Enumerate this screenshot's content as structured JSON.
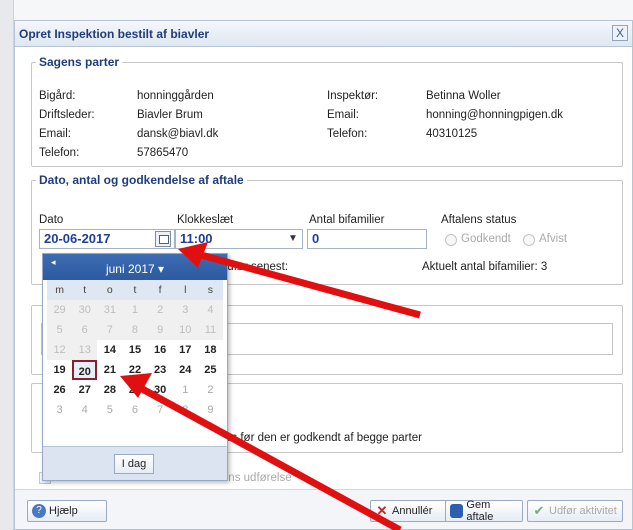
{
  "dialog": {
    "title": "Opret Inspektion bestilt af biavler",
    "close_label": "X"
  },
  "parties": {
    "legend": "Sagens parter",
    "left": [
      {
        "label": "Bigård:",
        "value": "honninggården"
      },
      {
        "label": "Driftsleder:",
        "value": "Biavler Brum"
      },
      {
        "label": "Email:",
        "value": "dansk@biavl.dk"
      },
      {
        "label": "Telefon:",
        "value": "57865470"
      }
    ],
    "right": [
      {
        "label": "Inspektør:",
        "value": "Betinna Woller"
      },
      {
        "label": "Email:",
        "value": "honning@honningpigen.dk"
      },
      {
        "label": "Telefon:",
        "value": "40310125"
      }
    ]
  },
  "agreement": {
    "legend": "Dato, antal og godkendelse af aftale",
    "date_label": "Dato",
    "date_value": "20-06-2017",
    "time_label": "Klokkeslæt",
    "time_value": "11:00",
    "colonies_label": "Antal bifamilier",
    "colonies_value": "0",
    "status_label": "Aftalens status",
    "status_options": [
      "Godkendt",
      "Afvist"
    ],
    "latest_label": "Udfør senest:",
    "current_colonies": "Aktuelt antal bifamilier: 3"
  },
  "approval_text": "fres før den er godkendt af begge parter",
  "beekeeper_present": "Biavleren er tilstede ved aktivitetens udførelse",
  "datepicker": {
    "prev": "◂",
    "month": "juni 2017 ▾",
    "dow": [
      "m",
      "t",
      "o",
      "t",
      "f",
      "l",
      "s"
    ],
    "weeks": [
      [
        "29",
        "30",
        "31",
        "1",
        "2",
        "3",
        "4"
      ],
      [
        "5",
        "6",
        "7",
        "8",
        "9",
        "10",
        "11"
      ],
      [
        "12",
        "13",
        "14",
        "15",
        "16",
        "17",
        "18"
      ],
      [
        "19",
        "20",
        "21",
        "22",
        "23",
        "24",
        "25"
      ],
      [
        "26",
        "27",
        "28",
        "29",
        "30",
        "1",
        "2"
      ],
      [
        "3",
        "4",
        "5",
        "6",
        "7",
        "8",
        "9"
      ]
    ],
    "today_label": "I dag"
  },
  "buttons": {
    "help": "Hjælp",
    "cancel": "Annullér",
    "save": "Gem aftale",
    "perform": "Udfør aktivitet"
  },
  "colors": {
    "accent": "#1f3d7a",
    "arrow": "#e01010",
    "selected_border": "#8a1f2d"
  }
}
